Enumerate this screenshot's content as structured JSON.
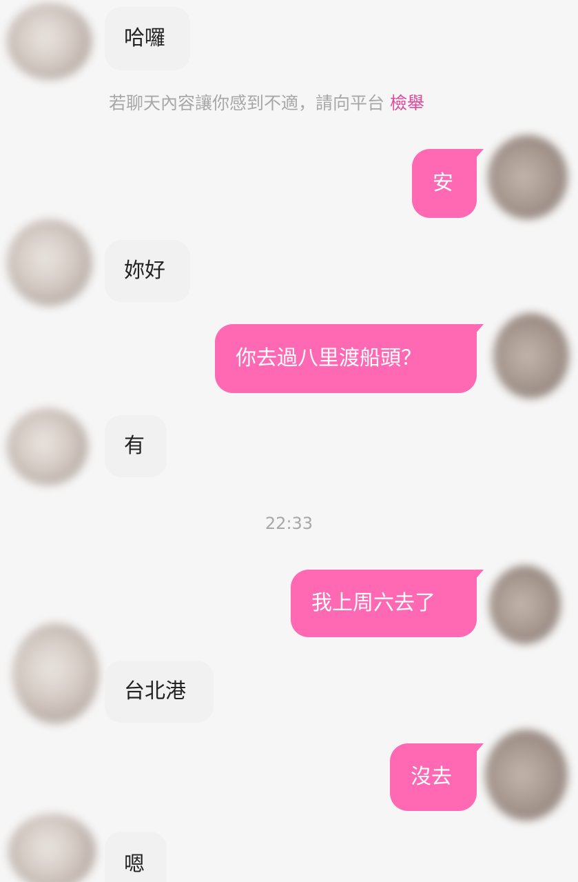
{
  "colors": {
    "outgoing_bubble": "#ff69b4",
    "incoming_bubble": "#f1f1f1",
    "report_link": "#e0489a",
    "background": "#f6f6f6"
  },
  "messages": [
    {
      "side": "in",
      "text": "哈囉"
    },
    {
      "side": "out",
      "text": "安"
    },
    {
      "side": "in",
      "text": "妳好"
    },
    {
      "side": "out",
      "text": "你去過八里渡船頭？"
    },
    {
      "side": "in",
      "text": "有"
    },
    {
      "side": "out",
      "text": "我上周六去了"
    },
    {
      "side": "in",
      "text": "台北港"
    },
    {
      "side": "out",
      "text": "沒去"
    },
    {
      "side": "in",
      "text": "嗯"
    }
  ],
  "notice": {
    "text": "若聊天內容讓你感到不適，請向平台",
    "link": "檢舉"
  },
  "timestamp": "22:33",
  "icons": [
    "blurred-avatar-icon"
  ]
}
